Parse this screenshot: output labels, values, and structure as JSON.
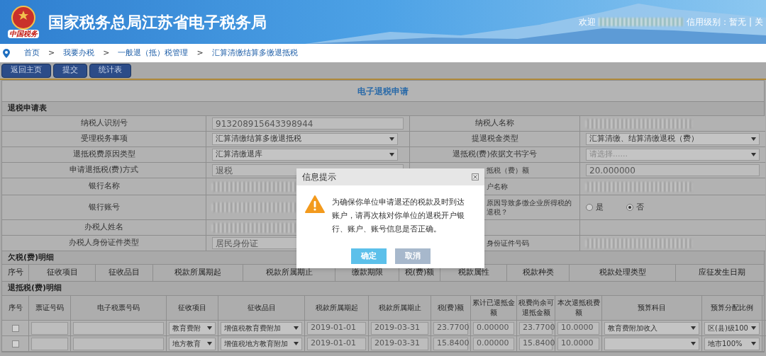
{
  "header": {
    "emblem_caption": "中国税务",
    "title": "国家税务总局江苏省电子税务局",
    "welcome": "欢迎",
    "credit": "信用级别：暂无",
    "separator": "|",
    "cut_link": "关"
  },
  "breadcrumb": {
    "separator": ">",
    "items": [
      "首页",
      "我要办税",
      "一般退（抵）税管理",
      "汇算清缴结算多缴退抵税"
    ]
  },
  "toolbar": [
    "返回主页",
    "提交",
    "统计表"
  ],
  "form": {
    "title": "电子退税申请",
    "section": "退税申请表",
    "rows": [
      [
        {
          "kind": "label",
          "text": "纳税人识别号"
        },
        {
          "kind": "text",
          "text": "913208915643398944"
        },
        {
          "kind": "label",
          "text": "纳税人名称"
        },
        {
          "kind": "blurred"
        }
      ],
      [
        {
          "kind": "label",
          "text": "受理税务事项"
        },
        {
          "kind": "select",
          "text": "汇算清缴结算多缴退抵税"
        },
        {
          "kind": "label",
          "text": "提退税金类型"
        },
        {
          "kind": "select",
          "text": "汇算清缴、结算清缴退税（费）"
        }
      ],
      [
        {
          "kind": "label",
          "text": "退抵税费原因类型"
        },
        {
          "kind": "select",
          "text": "汇算清缴退库"
        },
        {
          "kind": "label",
          "text": "退抵税(费)依据文书字号"
        },
        {
          "kind": "select",
          "placeholder": "请选择......"
        }
      ],
      [
        {
          "kind": "label",
          "text": "申请退抵税(费)方式"
        },
        {
          "kind": "text",
          "text": "退税"
        },
        {
          "kind": "label",
          "text": "抵税（费）额",
          "clipped": true
        },
        {
          "kind": "text",
          "text": "20.000000"
        }
      ],
      [
        {
          "kind": "label",
          "text": "银行名称"
        },
        {
          "kind": "blurred"
        },
        {
          "kind": "label",
          "text": "户名称",
          "clipped": true
        },
        {
          "kind": "blurred"
        }
      ],
      [
        {
          "kind": "label",
          "text": "银行账号"
        },
        {
          "kind": "blurred"
        },
        {
          "kind": "label",
          "text": "原因导致多缴企业所得税的退税？",
          "clipped": true
        },
        {
          "kind": "radio",
          "options": [
            {
              "label": "是",
              "selected": false
            },
            {
              "label": "否",
              "selected": true
            }
          ]
        }
      ],
      [
        {
          "kind": "label",
          "text": "办税人姓名"
        },
        {
          "kind": "blurred"
        },
        {
          "kind": "empty"
        },
        {
          "kind": "empty"
        }
      ],
      [
        {
          "kind": "label",
          "text": "办税人身份证件类型"
        },
        {
          "kind": "text",
          "text": "居民身份证"
        },
        {
          "kind": "label",
          "text": "身份证件号码",
          "clipped": true
        },
        {
          "kind": "blurred"
        }
      ]
    ]
  },
  "arrears": {
    "title": "欠税(费)明细",
    "columns": [
      "序号",
      "征收项目",
      "征收品目",
      "税款所属期起",
      "税款所属期止",
      "缴款期限",
      "税(费)额",
      "税款属性",
      "税款种类",
      "税款处理类型",
      "应征发生日期"
    ]
  },
  "refunds": {
    "title": "退抵税(费)明细",
    "columns": [
      "序号",
      "票证号码",
      "电子税票号码",
      "征收项目",
      "征收品目",
      "税款所属期起",
      "税款所属期止",
      "税(费)额",
      "累计已退抵金额",
      "税费尚余可退抵金额",
      "本次退抵税费额",
      "预算科目",
      "预算分配比例"
    ],
    "rows": [
      [
        {
          "kind": "checkbox",
          "checked": false
        },
        {
          "kind": "input"
        },
        {
          "kind": "input"
        },
        {
          "kind": "select",
          "value": "教育费附"
        },
        {
          "kind": "select",
          "value": "增值税教育费附加"
        },
        {
          "kind": "input",
          "value": "2019-01-01"
        },
        {
          "kind": "input",
          "value": "2019-03-31"
        },
        {
          "kind": "input",
          "value": "23.7700"
        },
        {
          "kind": "input",
          "value": "0.00000"
        },
        {
          "kind": "input",
          "value": "23.7700"
        },
        {
          "kind": "input",
          "value": "10.0000"
        },
        {
          "kind": "select",
          "value": "教育费附加收入"
        },
        {
          "kind": "select",
          "value": "区(县)级100"
        }
      ],
      [
        {
          "kind": "checkbox",
          "checked": false
        },
        {
          "kind": "input"
        },
        {
          "kind": "input"
        },
        {
          "kind": "select",
          "value": "地方教育"
        },
        {
          "kind": "select",
          "value": "增值税地方教育附加"
        },
        {
          "kind": "input",
          "value": "2019-01-01"
        },
        {
          "kind": "input",
          "value": "2019-03-31"
        },
        {
          "kind": "input",
          "value": "15.8400"
        },
        {
          "kind": "input",
          "value": "0.00000"
        },
        {
          "kind": "input",
          "value": "15.8400"
        },
        {
          "kind": "input",
          "value": "10.0000"
        },
        {
          "kind": "select"
        },
        {
          "kind": "select",
          "value": "地市100%"
        }
      ]
    ]
  },
  "dialog": {
    "title": "信息提示",
    "message": "为确保你单位申请退还的税款及时到达账户，请再次核对你单位的退税开户银行、账户、账号信息是否正确。",
    "buttons": [
      {
        "label": "确定",
        "kind": "primary"
      },
      {
        "label": "取消",
        "kind": "secondary"
      }
    ]
  }
}
